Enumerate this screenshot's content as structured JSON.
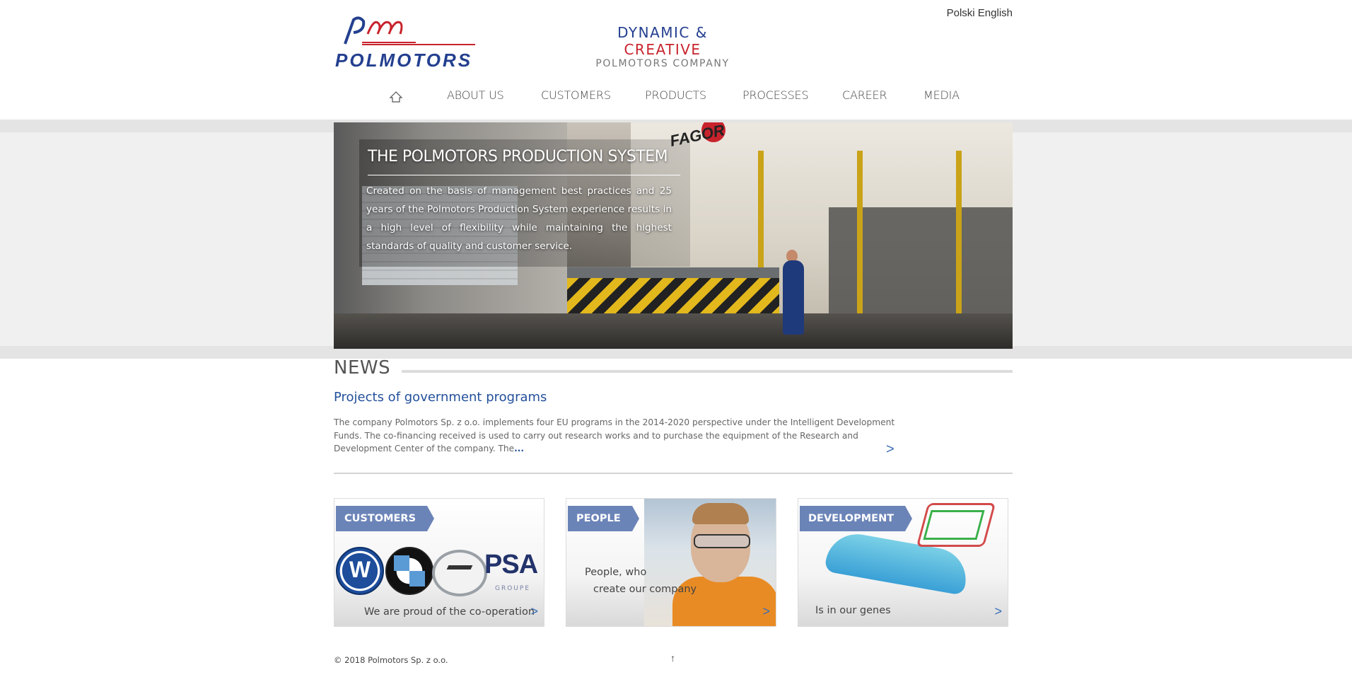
{
  "header": {
    "logo_text": "POLMOTORS",
    "tagline": {
      "dynamic": "DYNAMIC",
      "amp": "&",
      "creative": "CREATIVE",
      "company": "POLMOTORS COMPANY"
    },
    "languages": [
      "Polski",
      "English"
    ]
  },
  "nav": {
    "items": [
      "ABOUT US",
      "CUSTOMERS",
      "PRODUCTS",
      "PROCESSES",
      "CAREER",
      "MEDIA"
    ]
  },
  "hero": {
    "title": "THE POLMOTORS PRODUCTION SYSTEM",
    "text": "Created on the basis of management best practices and 25 years of the Polmotors Production System experience results in a high level of flexibility while maintaining the highest standards of quality and customer service.",
    "machine_label": "FAGOR"
  },
  "news": {
    "heading": "NEWS",
    "title": "Projects of government programs",
    "body": "The company Polmotors Sp. z o.o. implements four EU programs in the 2014-2020 perspective under the Intelligent Development Funds. The co-financing received is used to carry out research works and to purchase the equipment of the Research and Development Center of the company. The",
    "more": "...",
    "arrow": ">"
  },
  "tiles": {
    "customers": {
      "label": "CUSTOMERS",
      "caption": "We are proud of the co-operation",
      "arrow": ">",
      "logo_psa": "PSA",
      "logo_psa_sub": "GROUPE",
      "logo_vw": "W"
    },
    "people": {
      "label": "PEOPLE",
      "caption_line1": "People, who",
      "caption_line2": "create our company",
      "arrow": ">"
    },
    "development": {
      "label": "DEVELOPMENT",
      "caption": "Is in our genes",
      "arrow": ">"
    }
  },
  "footer": {
    "copyright": "© 2018 Polmotors Sp. z o.o.",
    "up_arrow": "↑"
  },
  "colors": {
    "brand_blue": "#233f8f",
    "brand_red": "#c8232c",
    "link_blue": "#23509b",
    "ribbon": "#6b84b8"
  }
}
